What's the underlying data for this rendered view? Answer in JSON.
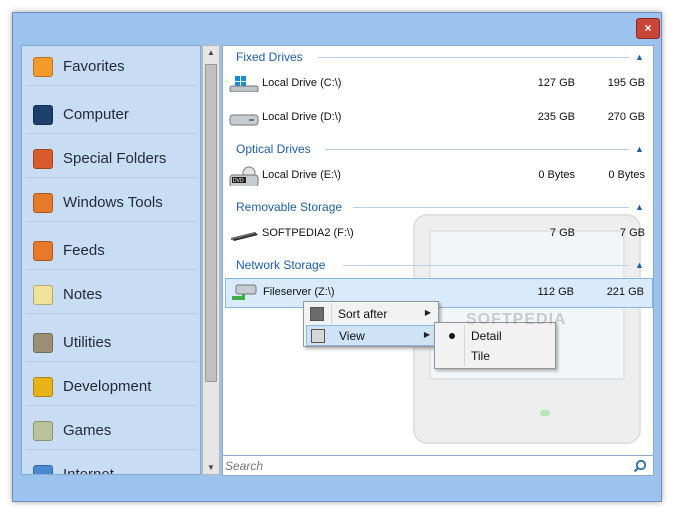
{
  "window": {
    "close_label": "×"
  },
  "sidebar": {
    "items": [
      {
        "label": "Favorites",
        "icon": "star-icon",
        "color": "#f39c2a"
      },
      {
        "label": "Computer",
        "icon": "monitor-icon",
        "color": "#1d3f6e"
      },
      {
        "label": "Special Folders",
        "icon": "windows-logo-icon",
        "color": "#d95a2b"
      },
      {
        "label": "Windows Tools",
        "icon": "tools-icon",
        "color": "#e47a2a"
      },
      {
        "label": "Feeds",
        "icon": "rss-icon",
        "color": "#e8792b"
      },
      {
        "label": "Notes",
        "icon": "notes-icon",
        "color": "#efe29a"
      },
      {
        "label": "Utilities",
        "icon": "calculator-icon",
        "color": "#9a8f74"
      },
      {
        "label": "Development",
        "icon": "construction-icon",
        "color": "#e7b318"
      },
      {
        "label": "Games",
        "icon": "gamepad-icon",
        "color": "#b9c39a"
      },
      {
        "label": "Internet",
        "icon": "globe-icon",
        "color": "#4b8ad0"
      }
    ]
  },
  "groups": [
    {
      "title": "Fixed Drives",
      "rows": [
        {
          "name": "Local Drive (C:\\)",
          "free": "127 GB",
          "total": "195 GB",
          "icon": "system-drive-icon"
        },
        {
          "name": "Local Drive (D:\\)",
          "free": "235 GB",
          "total": "270 GB",
          "icon": "hard-drive-icon"
        }
      ]
    },
    {
      "title": "Optical Drives",
      "rows": [
        {
          "name": "Local Drive (E:\\)",
          "free": "0 Bytes",
          "total": "0 Bytes",
          "icon": "dvd-drive-icon",
          "badge": "DVD"
        }
      ]
    },
    {
      "title": "Removable Storage",
      "rows": [
        {
          "name": "SOFTPEDIA2 (F:\\)",
          "free": "7 GB",
          "total": "7 GB",
          "icon": "usb-drive-icon"
        }
      ]
    },
    {
      "title": "Network Storage",
      "rows": [
        {
          "name": "Fileserver (Z:\\)",
          "free": "112 GB",
          "total": "221 GB",
          "icon": "network-drive-icon",
          "selected": true
        }
      ]
    }
  ],
  "context_menu": {
    "items": [
      {
        "label": "Sort after",
        "icon": "sort-icon"
      },
      {
        "label": "View",
        "icon": "view-grid-icon",
        "highlighted": true
      }
    ],
    "submenu": [
      {
        "label": "Detail",
        "checked": true
      },
      {
        "label": "Tile",
        "checked": false
      }
    ]
  },
  "search": {
    "placeholder": "Search"
  },
  "watermark": "SOFTPEDIA"
}
